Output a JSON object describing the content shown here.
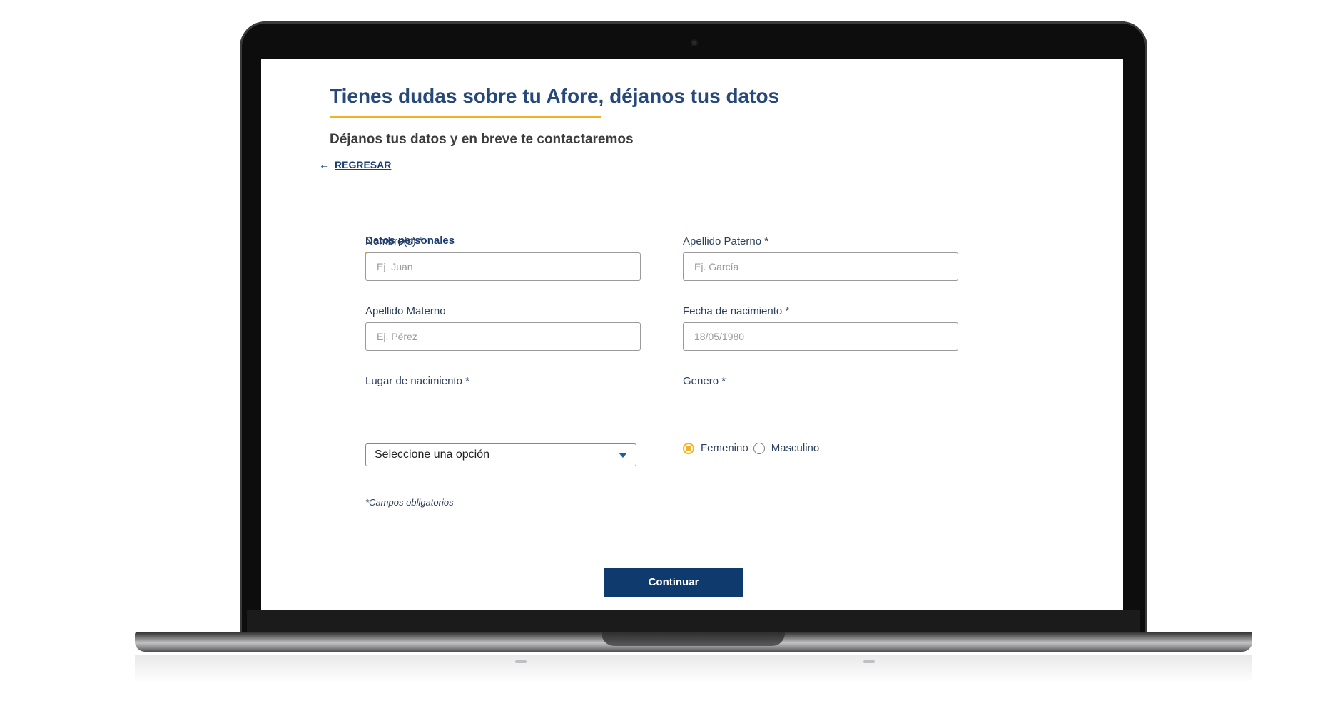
{
  "page": {
    "title": "Tienes dudas sobre tu Afore, déjanos tus datos",
    "subtitle": "Déjanos tus datos y en breve te contactaremos",
    "back_arrow": "←",
    "back_label": "REGRESAR"
  },
  "section": {
    "title": "Datos personales"
  },
  "form": {
    "nombre": {
      "label": "Nombre(s) *",
      "placeholder": "Ej. Juan",
      "value": ""
    },
    "apellido_paterno": {
      "label": "Apellido Paterno *",
      "placeholder": "Ej. García",
      "value": ""
    },
    "apellido_materno": {
      "label": "Apellido Materno",
      "placeholder": "Ej. Pérez",
      "value": ""
    },
    "fecha_nacimiento": {
      "label": "Fecha de nacimiento *",
      "placeholder": "18/05/1980",
      "value": ""
    },
    "lugar_nacimiento": {
      "label": "Lugar de nacimiento *",
      "selected": "Seleccione una opción"
    },
    "genero": {
      "label": "Genero *",
      "options": [
        {
          "label": "Femenino",
          "checked": true
        },
        {
          "label": "Masculino",
          "checked": false
        }
      ]
    },
    "required_note": "*Campos obligatorios",
    "continue_label": "Continuar"
  },
  "colors": {
    "title_blue": "#27497a",
    "accent_yellow": "#f0b323",
    "button_navy": "#0f3a6e"
  },
  "icons": {
    "back": "left-arrow-icon",
    "select": "caret-down-icon"
  }
}
